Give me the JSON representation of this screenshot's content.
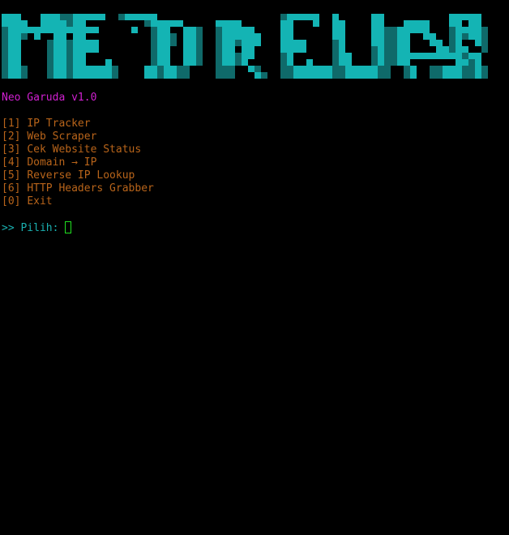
{
  "terminal": {
    "banner_colors": {
      "block": "#14b4b4",
      "shade": "#0f6a6a"
    },
    "title": "Neo Garuda v1.0",
    "title_color": "#d020d0",
    "menu": [
      {
        "key": "[1]",
        "label": "IP Tracker"
      },
      {
        "key": "[2]",
        "label": "Web Scraper"
      },
      {
        "key": "[3]",
        "label": "Cek Website Status"
      },
      {
        "key": "[4]",
        "label": "Domain → IP"
      },
      {
        "key": "[5]",
        "label": "Reverse IP Lookup"
      },
      {
        "key": "[6]",
        "label": "HTTP Headers Grabber"
      },
      {
        "key": "[0]",
        "label": "Exit"
      }
    ],
    "menu_color": "#b8641a",
    "prompt": ">> Pilih:",
    "prompt_color": "#1ab0b0",
    "input_value": ""
  }
}
